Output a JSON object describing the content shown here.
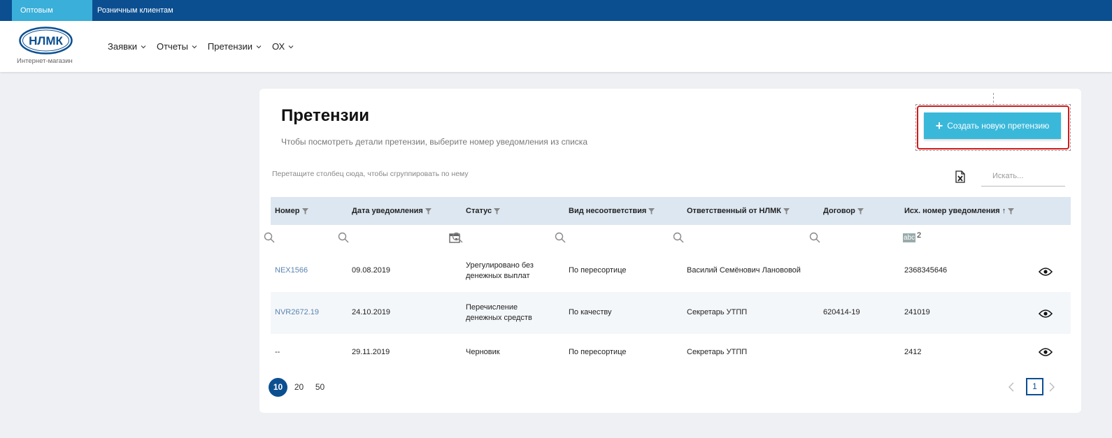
{
  "topbar": {
    "wholesale": "Оптовым клиентам",
    "retail": "Розничным клиентам"
  },
  "header": {
    "logo_text": "НЛМК",
    "logo_sub": "Интернет-магазин",
    "nav": [
      "Заявки",
      "Отчеты",
      "Претензии",
      "ОХ"
    ]
  },
  "page": {
    "title": "Претензии",
    "description": "Чтобы посмотреть детали претензии, выберите номер уведомления из списка",
    "create_button": "Создать новую претензию",
    "group_hint": "Перетащите столбец сюда, чтобы сгруппировать по нему",
    "search_placeholder": "Искать..."
  },
  "grid": {
    "columns": [
      "Номер",
      "Дата уведомления",
      "Статус",
      "Вид несоответствия",
      "Ответственный от НЛМК",
      "Договор",
      "Исх. номер уведомления"
    ],
    "sort_indicator": "↑",
    "filter_value_last": "2",
    "abc_label": "abc",
    "rows": [
      {
        "number": "NEX1566",
        "date": "09.08.2019",
        "status_1": "Урегулировано без",
        "status_2": "денежных выплат",
        "type": "По пересортице",
        "responsible": "Василий Семёнович Ланововой",
        "contract": "",
        "out_number": "2368345646"
      },
      {
        "number": "NVR2672.19",
        "date": "24.10.2019",
        "status_1": "Перечисление",
        "status_2": "денежных средств",
        "type": "По качеству",
        "responsible": "Секретарь УТПП",
        "contract": "620414-19",
        "out_number": "241019"
      },
      {
        "number": "--",
        "date": "29.11.2019",
        "status_1": "Черновик",
        "status_2": "",
        "type": "По пересортице",
        "responsible": "Секретарь УТПП",
        "contract": "",
        "out_number": "2412"
      }
    ]
  },
  "pager": {
    "sizes": [
      "10",
      "20",
      "50"
    ],
    "active_size": "10",
    "current_page": "1"
  },
  "colors": {
    "brand_blue": "#0b4f91",
    "accent_cyan": "#3ab8da",
    "highlight_red": "#d31b1b"
  }
}
